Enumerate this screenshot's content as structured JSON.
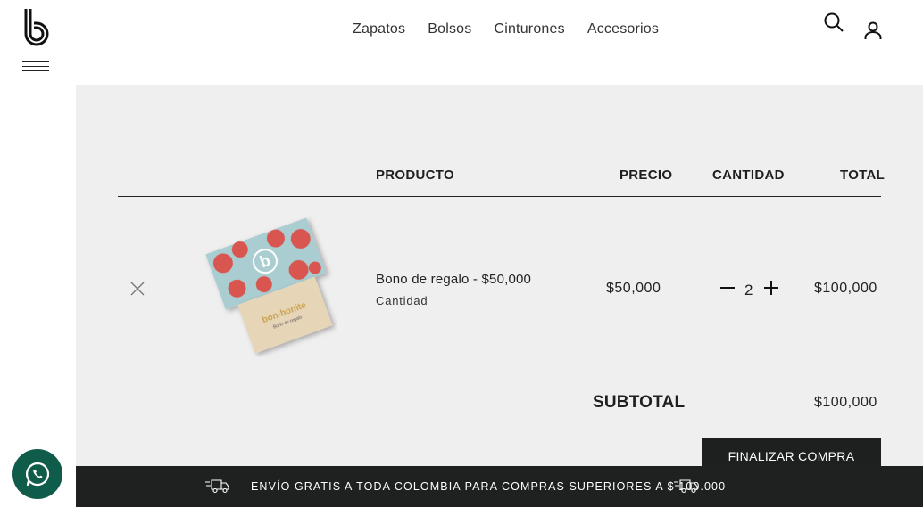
{
  "nav": {
    "items": [
      {
        "label": "Zapatos"
      },
      {
        "label": "Bolsos"
      },
      {
        "label": "Cinturones"
      },
      {
        "label": "Accesorios"
      }
    ]
  },
  "icons": {
    "logo": "brand-b-logo",
    "menu": "hamburger-icon",
    "search": "search-icon",
    "user": "user-icon",
    "remove": "close-icon",
    "minus": "minus-icon",
    "plus": "plus-icon",
    "truck": "truck-icon",
    "whatsapp": "whatsapp-icon"
  },
  "cart": {
    "headers": {
      "producto": "PRODUCTO",
      "precio": "PRECIO",
      "cantidad": "CANTIDAD",
      "total": "TOTAL"
    },
    "items": [
      {
        "name": "Bono de regalo - $50,000",
        "sub": "Cantidad",
        "price": "$50,000",
        "quantity": "2",
        "total": "$100,000",
        "image_brand": "bon-bonite",
        "image_caption": "Bono de regalo"
      }
    ],
    "subtotal_label": "SUBTOTAL",
    "subtotal_value": "$100,000",
    "checkout_label": "FINALIZAR COMPRA"
  },
  "shipping": {
    "message": "ENVÍO GRATIS A TODA COLOMBIA PARA COMPRAS SUPERIORES A $ 100.000"
  },
  "colors": {
    "cart_bg": "#efefef",
    "dark": "#1f2020",
    "whatsapp": "#0f5c4b",
    "card_blue": "#a9cdd1",
    "card_red": "#d9544f",
    "card_beige": "#e7d5b8"
  }
}
